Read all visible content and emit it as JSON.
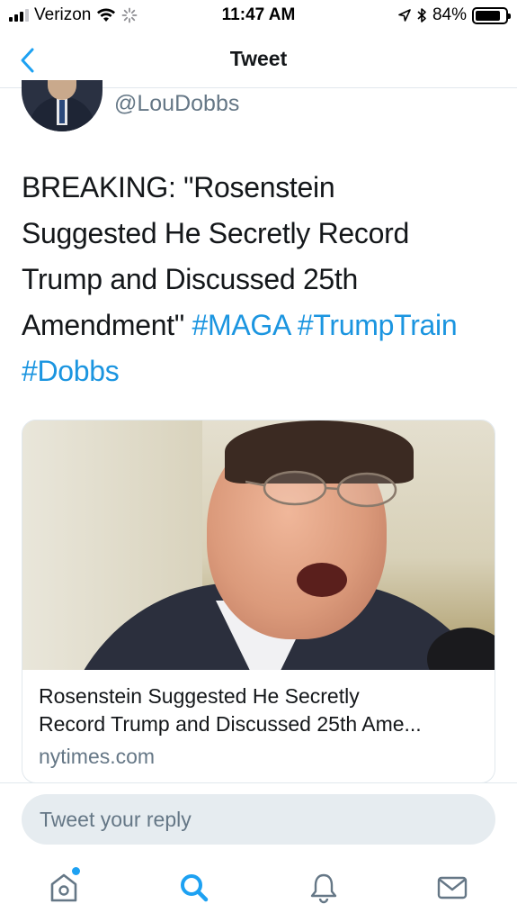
{
  "status_bar": {
    "carrier": "Verizon",
    "time": "11:47 AM",
    "battery_percent": "84%",
    "battery_level": 0.84,
    "icons": [
      "signal-icon",
      "wifi-icon",
      "loading-icon",
      "location-arrow-icon",
      "bluetooth-icon",
      "battery-icon"
    ]
  },
  "nav": {
    "title": "Tweet",
    "back_icon": "chevron-left-icon"
  },
  "author": {
    "handle": "@LouDobbs"
  },
  "tweet": {
    "text_line1": "BREAKING: \"Rosenstein",
    "text_line2": "Suggested He Secretly Record",
    "text_line3": "Trump and Discussed 25th",
    "text_line4_plain": "Amendment\"",
    "hashtag_1": "#MAGA",
    "hashtag_2": "#TrumpTrain",
    "hashtag_3": "#Dobbs"
  },
  "link_card": {
    "title_line1": "Rosenstein Suggested He Secretly",
    "title_line2": "Record Trump and Discussed 25th Ame...",
    "domain": "nytimes.com"
  },
  "reply": {
    "placeholder": "Tweet your reply"
  },
  "tab_bar": {
    "items": [
      {
        "icon": "home-icon",
        "active": false
      },
      {
        "icon": "search-icon",
        "active": true
      },
      {
        "icon": "bell-icon",
        "active": false
      },
      {
        "icon": "mail-icon",
        "active": false
      }
    ]
  },
  "colors": {
    "accent": "#1b95e0",
    "text": "#14171a",
    "secondary": "#657786",
    "divider": "#e1e8ed",
    "reply_bg": "#e6ecf0"
  }
}
